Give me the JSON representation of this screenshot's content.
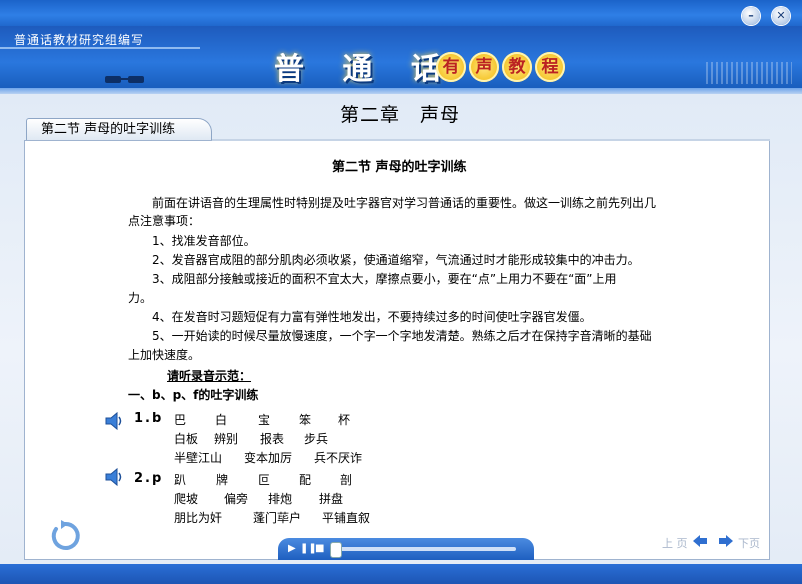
{
  "window": {
    "minimize_icon": "minimize-icon",
    "close_icon": "close-icon"
  },
  "header": {
    "organization": "普通话教材研究组编写",
    "title_main": "普 通 话",
    "title_circles": [
      "有",
      "声",
      "教",
      "程"
    ]
  },
  "chapter": {
    "title": "第二章　声母"
  },
  "tab": {
    "label": "第二节 声母的吐字训练"
  },
  "content": {
    "heading": "第二节 声母的吐字训练",
    "intro_line1": "前面在讲语音的生理属性时特别提及吐字器官对学习普通话的重要性。做这一训练之前先列出几",
    "intro_line2": "点注意事项：",
    "points": [
      "1、找准发音部位。",
      "2、发音器官成阻的部分肌肉必须收紧，使通道缩窄，气流通过时才能形成较集中的冲击力。",
      "3、成阻部分接触或接近的面积不宜太大，摩擦点要小，要在“点”上用力不要在“面”上用",
      "力。",
      "4、在发音时习题短促有力富有弹性地发出，不要持续过多的时间使吐字器官发僵。",
      "5、一开始读的时候尽量放慢速度，一个字一个字地发清楚。熟练之后才在保持字音清晰的基础",
      "上加快速度。"
    ],
    "listen_label": "请听录音示范：",
    "group_heading": "一、b、p、f的吐字训练",
    "exercises": [
      {
        "label": "1.b",
        "rows": [
          [
            "巴",
            "白",
            "宝",
            "笨",
            "杯"
          ],
          [
            "白板",
            "辨别",
            "报表",
            "步兵"
          ],
          [
            "半壁江山",
            "变本加厉",
            "兵不厌诈"
          ]
        ]
      },
      {
        "label": "2.p",
        "rows": [
          [
            "趴",
            "牌",
            "叵",
            "配",
            "剖"
          ],
          [
            "爬坡",
            "偏旁",
            "排炮",
            "拼盘"
          ],
          [
            "朋比为奸",
            "蓬门荜户",
            "平铺直叙"
          ]
        ]
      }
    ]
  },
  "footer": {
    "prev_label": "上 页",
    "next_label": "下页",
    "player_controls": [
      "▶",
      "❚❚",
      "■"
    ]
  },
  "colors": {
    "header_blue": "#2a77de",
    "panel_bg": "#ffffff",
    "accent_gold": "#f0b400"
  }
}
